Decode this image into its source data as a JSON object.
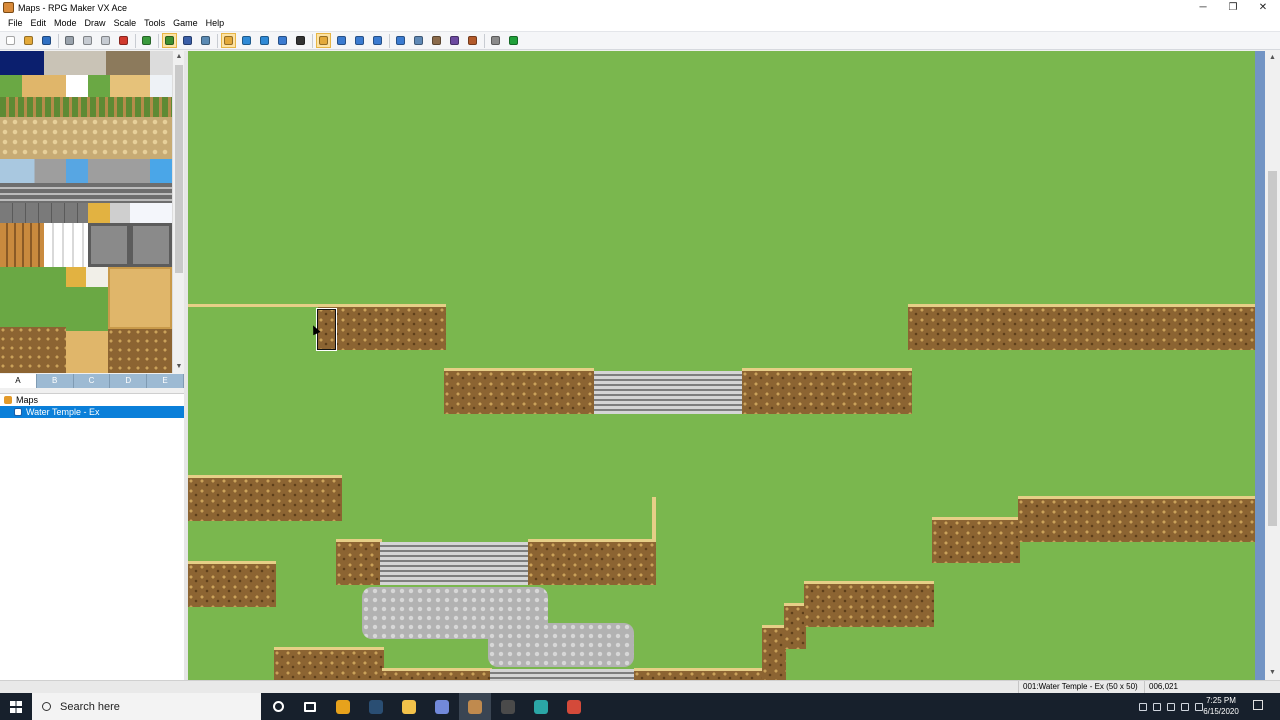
{
  "window": {
    "title": "Maps - RPG Maker VX Ace",
    "minimize": "─",
    "maximize": "❐",
    "close": "✕"
  },
  "menu": [
    "File",
    "Edit",
    "Mode",
    "Draw",
    "Scale",
    "Tools",
    "Game",
    "Help"
  ],
  "toolbar": [
    {
      "name": "new-project-icon",
      "color": "#ffffff"
    },
    {
      "name": "open-project-icon",
      "color": "#e3a93a"
    },
    {
      "name": "save-project-icon",
      "color": "#2f6fc2"
    },
    {
      "sep": true
    },
    {
      "name": "cut-icon",
      "color": "#9aa3ad"
    },
    {
      "name": "copy-icon",
      "color": "#c6cbd2"
    },
    {
      "name": "paste-icon",
      "color": "#c6cbd2"
    },
    {
      "name": "delete-icon",
      "color": "#d13a2e"
    },
    {
      "sep": true
    },
    {
      "name": "undo-icon",
      "color": "#3a9a3d"
    },
    {
      "sep": true
    },
    {
      "name": "map-layer-icon",
      "color": "#3e8f2f",
      "active": true
    },
    {
      "name": "event-layer-icon",
      "color": "#3a5fa8"
    },
    {
      "name": "region-layer-icon",
      "color": "#5a8ab3"
    },
    {
      "sep": true
    },
    {
      "name": "pencil-icon",
      "color": "#e3a93a",
      "active": true
    },
    {
      "name": "rectangle-icon",
      "color": "#2f8ad6"
    },
    {
      "name": "ellipse-icon",
      "color": "#2f8ad6"
    },
    {
      "name": "flood-fill-icon",
      "color": "#3b7bd0"
    },
    {
      "name": "shadow-pen-icon",
      "color": "#333333"
    },
    {
      "sep": true
    },
    {
      "name": "zoom-1-1-icon",
      "color": "#e3a93a",
      "active": true
    },
    {
      "name": "zoom-1-2-icon",
      "color": "#3b7bd0"
    },
    {
      "name": "zoom-1-4-icon",
      "color": "#3b7bd0"
    },
    {
      "name": "zoom-1-8-icon",
      "color": "#3b7bd0"
    },
    {
      "sep": true
    },
    {
      "name": "database-icon",
      "color": "#3b7bd0"
    },
    {
      "name": "resource-manager-icon",
      "color": "#5e88b5"
    },
    {
      "name": "script-editor-icon",
      "color": "#8a6a4a"
    },
    {
      "name": "sound-test-icon",
      "color": "#6b4aa0"
    },
    {
      "name": "character-generator-icon",
      "color": "#b35a2a"
    },
    {
      "sep": true
    },
    {
      "name": "game-folder-icon",
      "color": "#8a8a8a"
    },
    {
      "name": "playtest-icon",
      "color": "#20a03a"
    }
  ],
  "tileset": {
    "tabs": [
      "A",
      "B",
      "C",
      "D",
      "E"
    ],
    "active_tab": "A",
    "up_arrow": "▲",
    "down_arrow": "▼"
  },
  "map_tree": {
    "root": "Maps",
    "items": [
      "Water Temple - Ex"
    ],
    "selected": "Water Temple - Ex"
  },
  "status": {
    "map": "001:Water Temple - Ex (50 x 50)",
    "coords": "006,021"
  },
  "taskbar": {
    "search_placeholder": "Search here",
    "apps": [
      {
        "name": "cortana-icon",
        "color": "#17202c"
      },
      {
        "name": "task-view-icon",
        "color": "#17202c"
      },
      {
        "name": "chrome-icon",
        "color": "#e7a21c"
      },
      {
        "name": "steam-icon",
        "color": "#2a4e73"
      },
      {
        "name": "file-explorer-icon",
        "color": "#f2c14a"
      },
      {
        "name": "discord-icon",
        "color": "#7289da"
      },
      {
        "name": "rpg-maker-icon",
        "color": "#c08a4e"
      },
      {
        "name": "obs-icon",
        "color": "#4a4a4a"
      },
      {
        "name": "screen-sketch-icon",
        "color": "#2ba6a6"
      },
      {
        "name": "chrome-alt-icon",
        "color": "#d44a3a"
      }
    ],
    "time": "7:25 PM",
    "date": "6/15/2020"
  }
}
